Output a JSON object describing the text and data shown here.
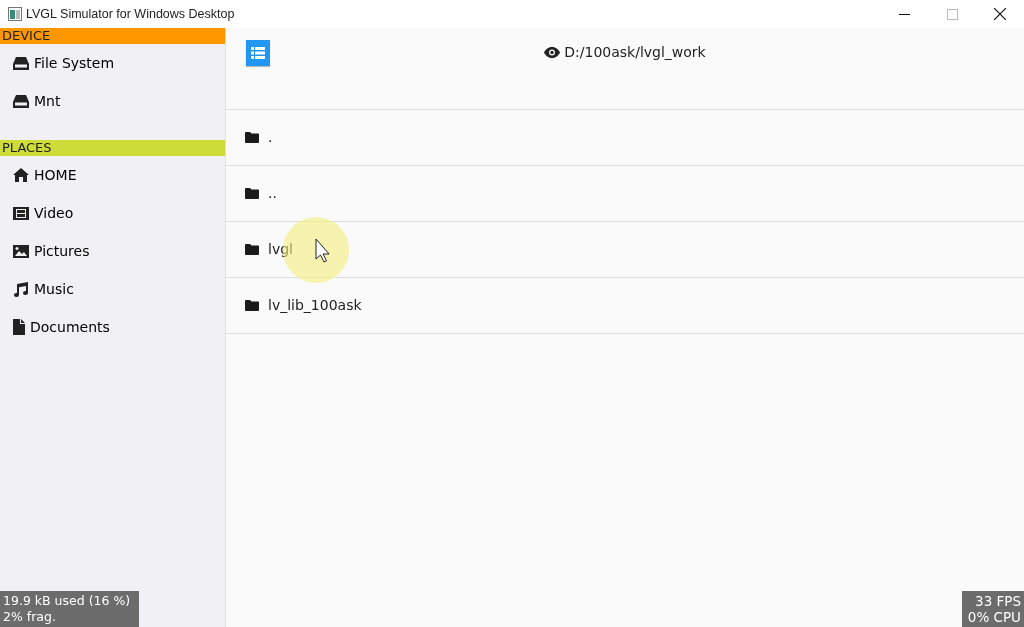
{
  "window": {
    "title": "LVGL Simulator for Windows Desktop"
  },
  "sidebar": {
    "sections": [
      {
        "title": "DEVICE",
        "color": "#ff9800",
        "items": [
          {
            "label": "File System",
            "kind": "drive"
          },
          {
            "label": "Mnt",
            "kind": "drive"
          }
        ]
      },
      {
        "title": "PLACES",
        "color": "#cddc39",
        "items": [
          {
            "label": "HOME",
            "kind": "home"
          },
          {
            "label": "Video",
            "kind": "film"
          },
          {
            "label": "Pictures",
            "kind": "image"
          },
          {
            "label": "Music",
            "kind": "music"
          },
          {
            "label": "Documents",
            "kind": "file"
          }
        ]
      }
    ]
  },
  "header": {
    "path": "D:/100ask/lvgl_work"
  },
  "files": [
    {
      "name": ".",
      "pointer": false
    },
    {
      "name": "..",
      "pointer": false
    },
    {
      "name": "lvgl",
      "pointer": true
    },
    {
      "name": "lv_lib_100ask",
      "pointer": false
    }
  ],
  "memory_monitor": {
    "lines": [
      "19.9 kB used (16 %)",
      "2% frag."
    ]
  },
  "perf_monitor": {
    "lines": [
      "33 FPS",
      "0% CPU"
    ]
  }
}
